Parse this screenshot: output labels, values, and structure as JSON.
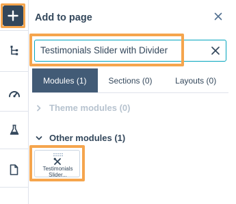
{
  "colors": {
    "accent": "#00a4bd",
    "highlight": "#f5a54d",
    "tab_active": "#425b76",
    "dark": "#33475b",
    "muted": "#b7c3cf"
  },
  "rail": {
    "items": [
      {
        "icon": "plus-icon",
        "label": ""
      },
      {
        "icon": "tree-structure-icon",
        "label": ""
      },
      {
        "icon": "speedometer-icon",
        "label": ""
      },
      {
        "icon": "flask-icon",
        "label": ""
      },
      {
        "icon": "page-icon",
        "label": ""
      }
    ]
  },
  "panel": {
    "title": "Add to page",
    "close_icon": "close-icon"
  },
  "search": {
    "value": "Testimonials Slider with Divider",
    "clear_icon": "close-icon"
  },
  "tabs": [
    {
      "label": "Modules (1)",
      "active": true
    },
    {
      "label": "Sections (0)",
      "active": false
    },
    {
      "label": "Layouts (0)",
      "active": false
    }
  ],
  "sections": {
    "theme": {
      "label": "Theme modules (0)",
      "expanded": false
    },
    "other": {
      "label": "Other modules (1)",
      "expanded": true
    }
  },
  "modules": [
    {
      "name_line1": "Testimonials",
      "name_line2": "Slider...",
      "icon": "tools-icon"
    }
  ]
}
